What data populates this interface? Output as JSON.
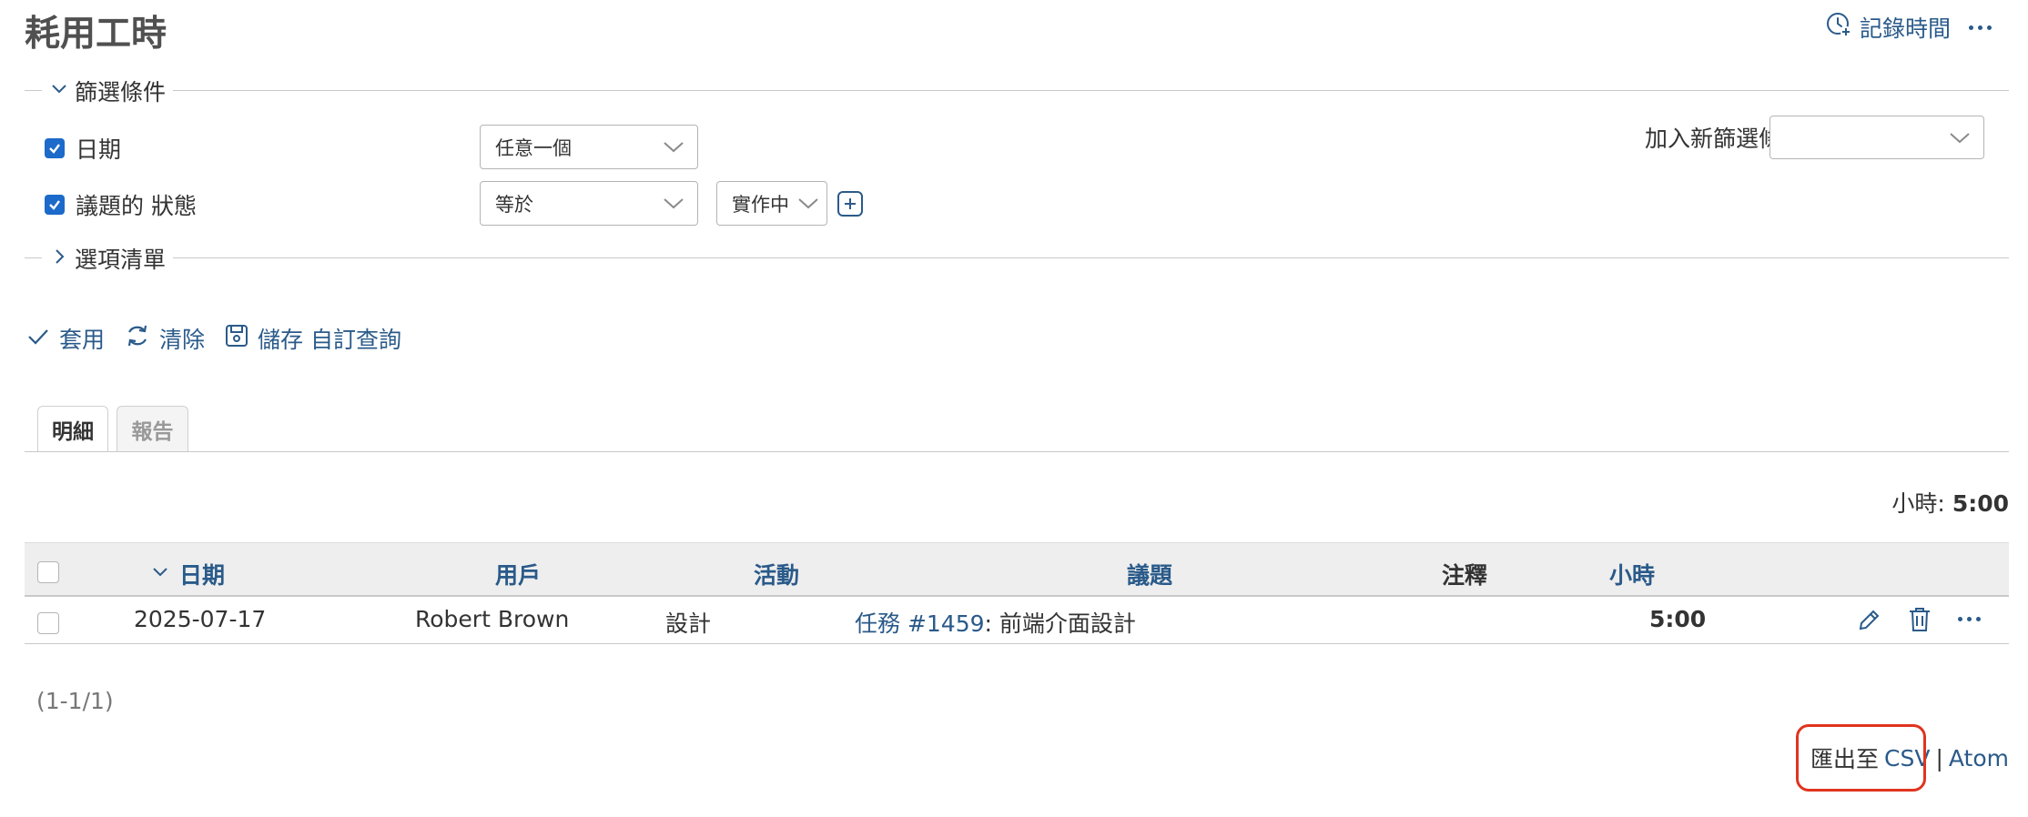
{
  "page": {
    "title": "耗用工時"
  },
  "header": {
    "log_time_label": "記錄時間"
  },
  "filters": {
    "legend": "篩選條件",
    "date": {
      "label": "日期",
      "operator": "任意一個"
    },
    "issue_status": {
      "label": "議題的 狀態",
      "operator": "等於",
      "value": "實作中"
    },
    "add_filter_label": "加入新篩選條件",
    "add_filter_value": ""
  },
  "options": {
    "legend": "選項清單"
  },
  "actions": {
    "apply": "套用",
    "clear": "清除",
    "save": "儲存 自訂查詢"
  },
  "tabs": [
    {
      "label": "明細",
      "active": true
    },
    {
      "label": "報告",
      "active": false
    }
  ],
  "totals": {
    "label": "小時:",
    "value": "5:00"
  },
  "table": {
    "columns": {
      "date": "日期",
      "user": "用戶",
      "activity": "活動",
      "issue": "議題",
      "comment": "注釋",
      "hours": "小時"
    },
    "rows": [
      {
        "date": "2025-07-17",
        "user": "Robert Brown",
        "activity": "設計",
        "issue_link": "任務 #1459",
        "issue_title": ": 前端介面設計",
        "comment": "",
        "hours": "5:00"
      }
    ]
  },
  "pagination": {
    "text": "(1-1/1)"
  },
  "export": {
    "prefix": "匯出至",
    "csv": "CSV",
    "separator": "|",
    "atom": "Atom"
  },
  "colors": {
    "link": "#2a5a8a",
    "checkbox": "#1c6ac9",
    "highlight": "#e0341f"
  }
}
